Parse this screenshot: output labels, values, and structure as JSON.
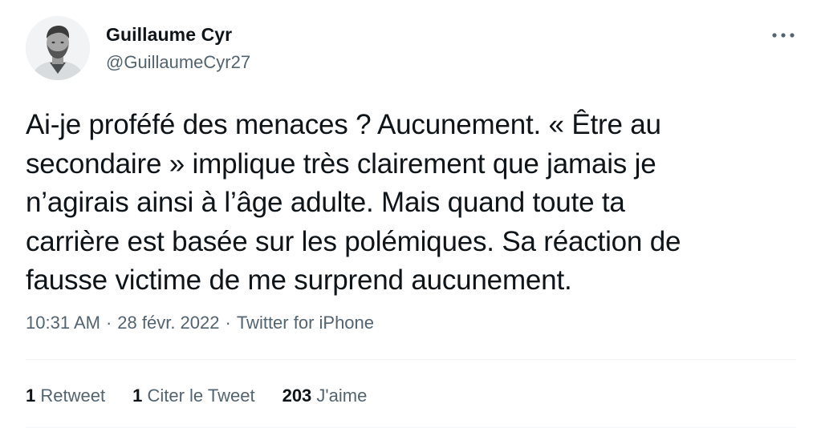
{
  "author": {
    "display_name": "Guillaume Cyr",
    "username": "@GuillaumeCyr27"
  },
  "tweet": {
    "text": "Ai-je proféfé des menaces ? Aucunement. « Être au\nsecondaire » implique très clairement que jamais je\nn’agirais ainsi à l’âge adulte. Mais quand toute ta\ncarrière est basée sur les polémiques. Sa réaction de\nfausse victime de me surprend aucunement.",
    "time": "10:31 AM",
    "date": "28 févr. 2022",
    "source": "Twitter for iPhone",
    "separator": "·"
  },
  "stats": {
    "retweets": {
      "count": "1",
      "label": "Retweet"
    },
    "quotes": {
      "count": "1",
      "label": "Citer le Tweet"
    },
    "likes": {
      "count": "203",
      "label": "J'aime"
    }
  },
  "icons": {
    "more": "more-horizontal-icon",
    "avatar": "profile-photo"
  },
  "colors": {
    "text_primary": "#0f1419",
    "text_secondary": "#536471",
    "divider": "#eff3f4"
  }
}
